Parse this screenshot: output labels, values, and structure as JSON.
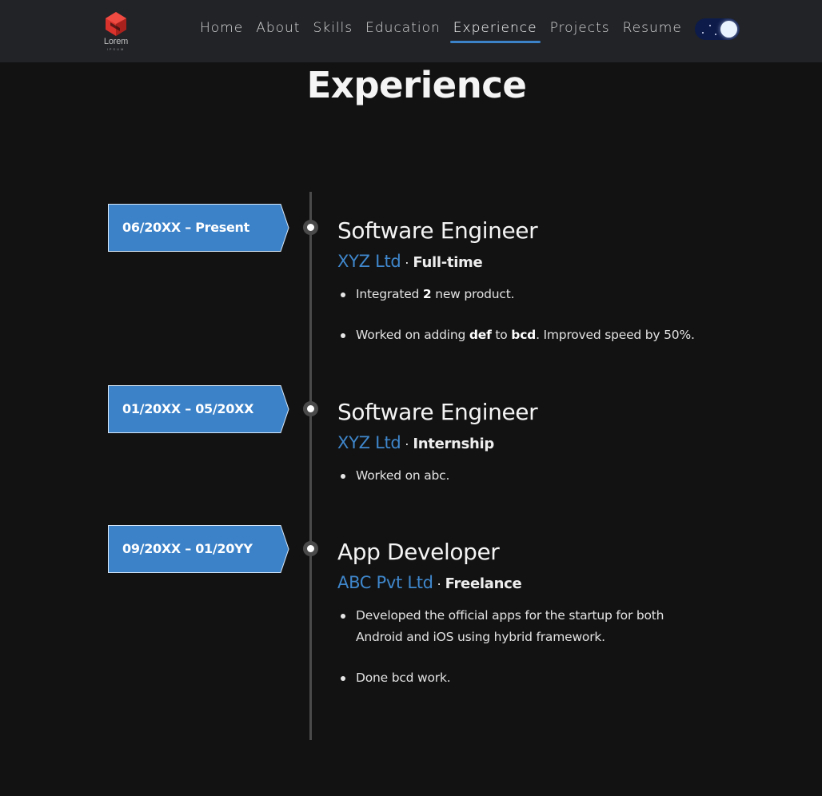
{
  "brand": {
    "logo_text": "Lorem",
    "logo_sub": "IPSUM",
    "logo_color": "#d9322c"
  },
  "nav": {
    "items": [
      {
        "label": "Home",
        "active": false
      },
      {
        "label": "About",
        "active": false
      },
      {
        "label": "Skills",
        "active": false
      },
      {
        "label": "Education",
        "active": false
      },
      {
        "label": "Experience",
        "active": true
      },
      {
        "label": "Projects",
        "active": false
      },
      {
        "label": "Resume",
        "active": false
      }
    ],
    "theme_toggle": {
      "mode": "dark",
      "icon": "moon-icon"
    }
  },
  "page": {
    "title": "Experience"
  },
  "colors": {
    "accent": "#3f87cc",
    "background": "#121212",
    "navbar": "#212327"
  },
  "experience": [
    {
      "date": "06/20XX – Present",
      "title": "Software Engineer",
      "company": "XYZ Ltd",
      "separator": "·",
      "type": "Full-time",
      "bullets": [
        [
          {
            "t": "Integrated "
          },
          {
            "t": "2",
            "b": true
          },
          {
            "t": " new product."
          }
        ],
        [
          {
            "t": "Worked on adding "
          },
          {
            "t": "def",
            "b": true
          },
          {
            "t": " to "
          },
          {
            "t": "bcd",
            "b": true
          },
          {
            "t": ". Improved speed by 50%."
          }
        ]
      ]
    },
    {
      "date": "01/20XX – 05/20XX",
      "title": "Software Engineer",
      "company": "XYZ Ltd",
      "separator": "·",
      "type": "Internship",
      "bullets": [
        [
          {
            "t": "Worked on abc."
          }
        ]
      ]
    },
    {
      "date": "09/20XX – 01/20YY",
      "title": "App Developer",
      "company": "ABC Pvt Ltd",
      "separator": "·",
      "type": "Freelance",
      "bullets": [
        [
          {
            "t": "Developed the official apps for the startup for both Android and iOS using hybrid framework."
          }
        ],
        [
          {
            "t": "Done bcd work."
          }
        ]
      ]
    }
  ]
}
